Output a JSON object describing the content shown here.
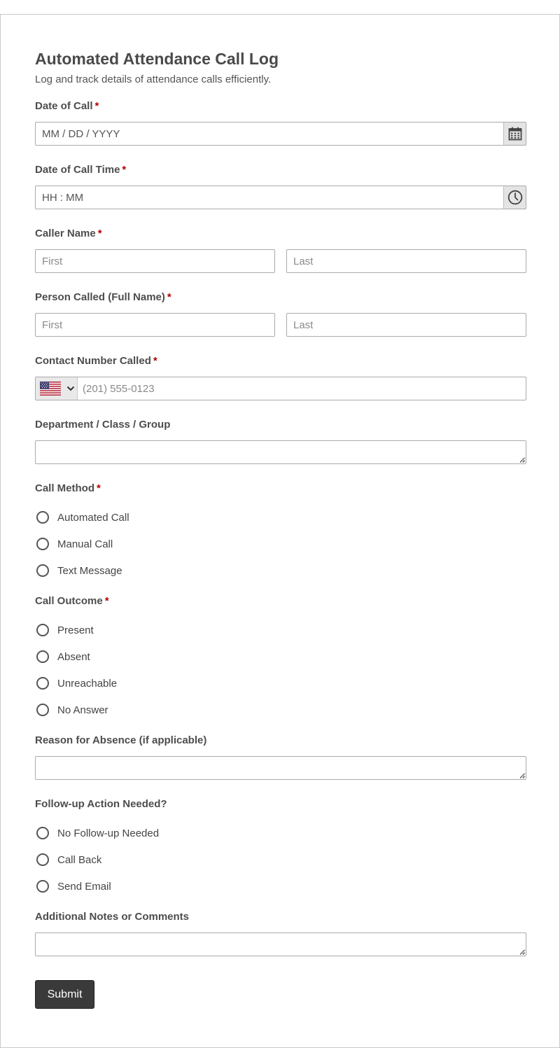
{
  "form": {
    "title": "Automated Attendance Call Log",
    "description": "Log and track details of attendance calls efficiently.",
    "required_marker": "*",
    "date_of_call": {
      "label": "Date of Call",
      "placeholder": "MM / DD / YYYY",
      "icon": "calendar-icon"
    },
    "call_time": {
      "label": "Date of Call Time",
      "placeholder": "HH : MM",
      "icon": "clock-icon"
    },
    "caller_name": {
      "label": "Caller Name",
      "first_placeholder": "First",
      "last_placeholder": "Last"
    },
    "person_called": {
      "label": "Person Called (Full Name)",
      "first_placeholder": "First",
      "last_placeholder": "Last"
    },
    "contact_number": {
      "label": "Contact Number Called",
      "country": "us-flag-icon",
      "placeholder": "(201) 555-0123"
    },
    "department": {
      "label": "Department / Class / Group",
      "value": ""
    },
    "call_method": {
      "label": "Call Method",
      "options": [
        "Automated Call",
        "Manual Call",
        "Text Message"
      ]
    },
    "call_outcome": {
      "label": "Call Outcome",
      "options": [
        "Present",
        "Absent",
        "Unreachable",
        "No Answer"
      ]
    },
    "reason_absence": {
      "label": "Reason for Absence (if applicable)",
      "value": ""
    },
    "follow_up": {
      "label": "Follow-up Action Needed?",
      "options": [
        "No Follow-up Needed",
        "Call Back",
        "Send Email"
      ]
    },
    "notes": {
      "label": "Additional Notes or Comments",
      "value": ""
    },
    "submit_label": "Submit"
  },
  "colors": {
    "required": "#b30000",
    "submit_bg": "#3a3a3a",
    "addon_bg": "#e4e4e4",
    "border": "#aaaaaa"
  }
}
